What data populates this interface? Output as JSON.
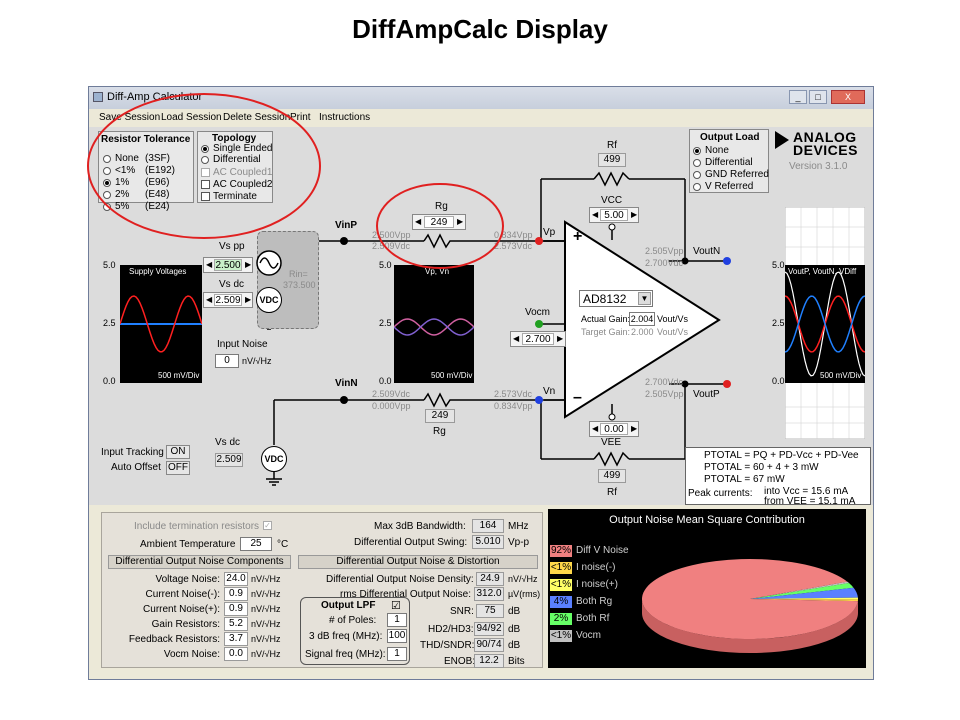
{
  "slide": {
    "title": "DiffAmpCalc Display"
  },
  "window": {
    "title": "Diff-Amp Calculator",
    "controls": [
      "_",
      "□",
      "X"
    ]
  },
  "menu": [
    "Save Session",
    "Load Session",
    "Delete Session",
    "Print",
    "Instructions"
  ],
  "resistor_tolerance": {
    "title": "Resistor Tolerance",
    "options": [
      {
        "label": "None",
        "code": "(3SF)",
        "selected": false
      },
      {
        "label": "<1%",
        "code": "(E192)",
        "selected": false
      },
      {
        "label": "1%",
        "code": "(E96)",
        "selected": true
      },
      {
        "label": "2%",
        "code": "(E48)",
        "selected": false
      },
      {
        "label": "5%",
        "code": "(E24)",
        "selected": false
      }
    ]
  },
  "topology": {
    "title": "Topology",
    "options": [
      {
        "label": "Single Ended",
        "selected": true
      },
      {
        "label": "Differential",
        "selected": false
      }
    ],
    "checks": [
      {
        "label": "AC Coupled1",
        "checked": false,
        "disabled": true
      },
      {
        "label": "AC Coupled2",
        "checked": false,
        "disabled": false
      },
      {
        "label": "Terminate",
        "checked": false,
        "disabled": false
      }
    ]
  },
  "output_load": {
    "title": "Output Load",
    "options": [
      {
        "label": "None",
        "selected": true
      },
      {
        "label": "Differential",
        "selected": false
      },
      {
        "label": "GND Referred",
        "selected": false
      },
      {
        "label": "V Referred",
        "selected": false
      }
    ]
  },
  "brand": {
    "line1": "ANALOG",
    "line2": "DEVICES",
    "version": "Version 3.1.0"
  },
  "circuit": {
    "rf_top_label": "Rf",
    "rf_top_value": "499",
    "rf_bottom_label": "Rf",
    "rf_bottom_value": "499",
    "rg_top_label": "Rg",
    "rg_top_value": "249",
    "rg_bottom_label": "Rg",
    "rg_bottom_value": "249",
    "vinp": "VinP",
    "vinn": "VinN",
    "vp": "Vp",
    "vn": "Vn",
    "voutn": "VoutN",
    "voutp": "VoutP",
    "vcc_label": "VCC",
    "vcc_value": "5.00",
    "vee_label": "VEE",
    "vee_value": "0.00",
    "vocm_label": "Vocm",
    "vocm_value": "2.700",
    "rg_top_left_vpp": "2.500Vpp",
    "rg_top_left_vdc": "2.509Vdc",
    "rg_top_right_vpp": "0.834Vpp",
    "rg_top_right_vdc": "2.573Vdc",
    "rg_bot_left_vdc": "2.509Vdc",
    "rg_bot_left_vpp": "0.000Vpp",
    "rg_bot_right_vdc": "2.573Vdc",
    "rg_bot_right_vpp": "0.834Vpp",
    "outn_vpp": "2.505Vpp",
    "outn_vdc": "2.700Vdc",
    "outp_vdc": "2.700Vdc",
    "outp_vpp": "2.505Vpp",
    "amp_part": "AD8132",
    "actual_gain_label": "Actual Gain:",
    "actual_gain_value": "2.004",
    "gain_unit": "Vout/Vs",
    "target_gain_label": "Target Gain:",
    "target_gain_value": "2.000",
    "target_unit": "Vout/Vs",
    "plus": "+",
    "minus": "–",
    "vs_pp_label": "Vs pp",
    "vs_pp_value": "2.500",
    "vs_dc_label": "Vs dc",
    "vs_dc_value": "2.509",
    "rin_label": "Rin=",
    "rin_value": "373.500",
    "vdc": "VDC",
    "input_noise_label": "Input Noise",
    "input_noise_value": "0",
    "input_noise_unit": "nV/√Hz",
    "vsdc2_label": "Vs dc",
    "vsdc2_value": "2.509",
    "input_tracking_label": "Input Tracking",
    "input_tracking_value": "ON",
    "auto_offset_label": "Auto Offset",
    "auto_offset_value": "OFF"
  },
  "scopes": {
    "left": {
      "title": "Supply Voltages",
      "div": "500 mV/Div",
      "y_top": "5.0",
      "y_mid": "2.5",
      "y_bot": "0.0"
    },
    "middle": {
      "title": "Vp, Vn",
      "div": "500 mV/Div",
      "y_top": "5.0",
      "y_mid": "2.5",
      "y_bot": "0.0"
    },
    "right": {
      "title": "VoutP, VoutN, VDiff",
      "div": "500 mV/Div",
      "y_top": "5.0",
      "y_mid": "2.5",
      "y_bot": "0.0"
    }
  },
  "power": {
    "line1": "PTOTAL = PQ + PD-Vcc + PD-Vee",
    "line2": "PTOTAL = 60 + 4 + 3 mW",
    "line3": "PTOTAL = 67 mW",
    "peak_label": "Peak currents:",
    "peak1": "into Vcc = 15.6 mA",
    "peak2": "from VEE = 15.1 mA"
  },
  "noise": {
    "include_term": "Include termination resistors",
    "ambient_label": "Ambient Temperature",
    "ambient_value": "25",
    "ambient_unit": "°C",
    "components_header": "Differential Output Noise Components",
    "components": [
      {
        "label": "Voltage Noise:",
        "value": "24.0",
        "unit": "nV/√Hz"
      },
      {
        "label": "Current Noise(-):",
        "value": "0.9",
        "unit": "nV/√Hz"
      },
      {
        "label": "Current Noise(+):",
        "value": "0.9",
        "unit": "nV/√Hz"
      },
      {
        "label": "Gain Resistors:",
        "value": "5.2",
        "unit": "nV/√Hz"
      },
      {
        "label": "Feedback Resistors:",
        "value": "3.7",
        "unit": "nV/√Hz"
      },
      {
        "label": "Vocm Noise:",
        "value": "0.0",
        "unit": "nV/√Hz"
      }
    ],
    "max_bw_label": "Max 3dB Bandwidth:",
    "max_bw_value": "164",
    "max_bw_unit": "MHz",
    "swing_label": "Differential Output Swing:",
    "swing_value": "5.010",
    "swing_unit": "Vp-p",
    "distortion_header": "Differential Output Noise & Distortion",
    "density_label": "Differential Output Noise Density:",
    "density_value": "24.9",
    "density_unit": "nV/√Hz",
    "rms_label": "rms Differential Output Noise:",
    "rms_value": "312.0",
    "rms_unit": "µV(rms)",
    "snr_label": "SNR:",
    "snr_value": "75",
    "snr_unit": "dB",
    "hd_label": "HD2/HD3:",
    "hd_value": "94/92",
    "hd_unit": "dB",
    "thd_label": "THD/SNDR:",
    "thd_value": "90/74",
    "thd_unit": "dB",
    "enob_label": "ENOB:",
    "enob_value": "12.2",
    "enob_unit": "Bits",
    "lpf_title": "Output LPF",
    "lpf_check": "☑",
    "poles_label": "# of Poles:",
    "poles_value": "1",
    "freq_label": "3 dB freq (MHz):",
    "freq_value": "100",
    "sig_label": "Signal freq (MHz):",
    "sig_value": "1"
  },
  "chart_data": {
    "type": "pie",
    "title": "Output Noise Mean Square Contribution",
    "slices": [
      {
        "label": "Diff V Noise",
        "tag": "92%",
        "value": 92,
        "color": "#f08080"
      },
      {
        "label": "I noise(-)",
        "tag": "<1%",
        "value": 0.7,
        "color": "#ffd84a"
      },
      {
        "label": "I noise(+)",
        "tag": "<1%",
        "value": 0.7,
        "color": "#ffff66"
      },
      {
        "label": "Both Rg",
        "tag": "4%",
        "value": 4,
        "color": "#5a80ff"
      },
      {
        "label": "Both Rf",
        "tag": "2%",
        "value": 2,
        "color": "#66ff66"
      },
      {
        "label": "Vocm",
        "tag": "<1%",
        "value": 0.6,
        "color": "#c0c0c0"
      }
    ]
  },
  "colors": {
    "annotation": "#e02020",
    "scope_bg": "#000000",
    "sine_red": "#ff2020",
    "sine_blue": "#2080ff"
  }
}
